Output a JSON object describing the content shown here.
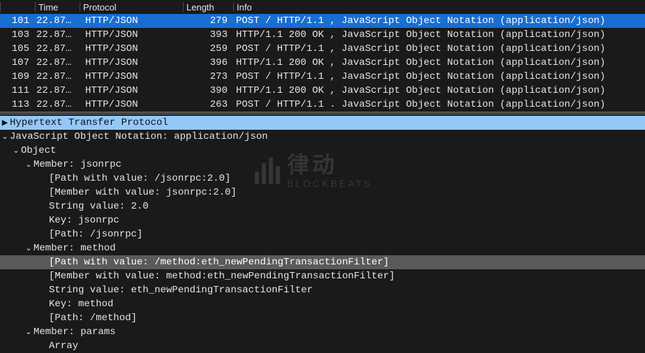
{
  "columns": {
    "no": "",
    "time": "Time",
    "protocol": "Protocol",
    "length": "Length",
    "info": "Info"
  },
  "packets": [
    {
      "no": "101",
      "time": "22.87…",
      "protocol": "HTTP/JSON",
      "length": "279",
      "info": "POST / HTTP/1.1 , JavaScript Object Notation (application/json)",
      "selected": true
    },
    {
      "no": "103",
      "time": "22.87…",
      "protocol": "HTTP/JSON",
      "length": "393",
      "info": "HTTP/1.1 200 OK , JavaScript Object Notation (application/json)"
    },
    {
      "no": "105",
      "time": "22.87…",
      "protocol": "HTTP/JSON",
      "length": "259",
      "info": "POST / HTTP/1.1 , JavaScript Object Notation (application/json)"
    },
    {
      "no": "107",
      "time": "22.87…",
      "protocol": "HTTP/JSON",
      "length": "396",
      "info": "HTTP/1.1 200 OK , JavaScript Object Notation (application/json)"
    },
    {
      "no": "109",
      "time": "22.87…",
      "protocol": "HTTP/JSON",
      "length": "273",
      "info": "POST / HTTP/1.1 , JavaScript Object Notation (application/json)"
    },
    {
      "no": "111",
      "time": "22.87…",
      "protocol": "HTTP/JSON",
      "length": "390",
      "info": "HTTP/1.1 200 OK , JavaScript Object Notation (application/json)"
    },
    {
      "no": "113",
      "time": "22.87…",
      "protocol": "HTTP/JSON",
      "length": "263",
      "info": "POST / HTTP/1.1 . JavaScript Object Notation (application/json)"
    }
  ],
  "detail": {
    "http": "Hypertext Transfer Protocol",
    "json_header": "JavaScript Object Notation: application/json",
    "object": "Object",
    "jsonrpc": {
      "member": "Member: jsonrpc",
      "path_value": "[Path with value: /jsonrpc:2.0]",
      "member_value": "[Member with value: jsonrpc:2.0]",
      "string_value": "String value: 2.0",
      "key": "Key: jsonrpc",
      "path": "[Path: /jsonrpc]"
    },
    "method": {
      "member": "Member: method",
      "path_value": "[Path with value: /method:eth_newPendingTransactionFilter]",
      "member_value": "[Member with value: method:eth_newPendingTransactionFilter]",
      "string_value": "String value: eth_newPendingTransactionFilter",
      "key": "Key: method",
      "path": "[Path: /method]"
    },
    "params": {
      "member": "Member: params",
      "array": "Array"
    }
  },
  "watermark": {
    "cn": "律动",
    "en": "BLOCKBEATS"
  }
}
